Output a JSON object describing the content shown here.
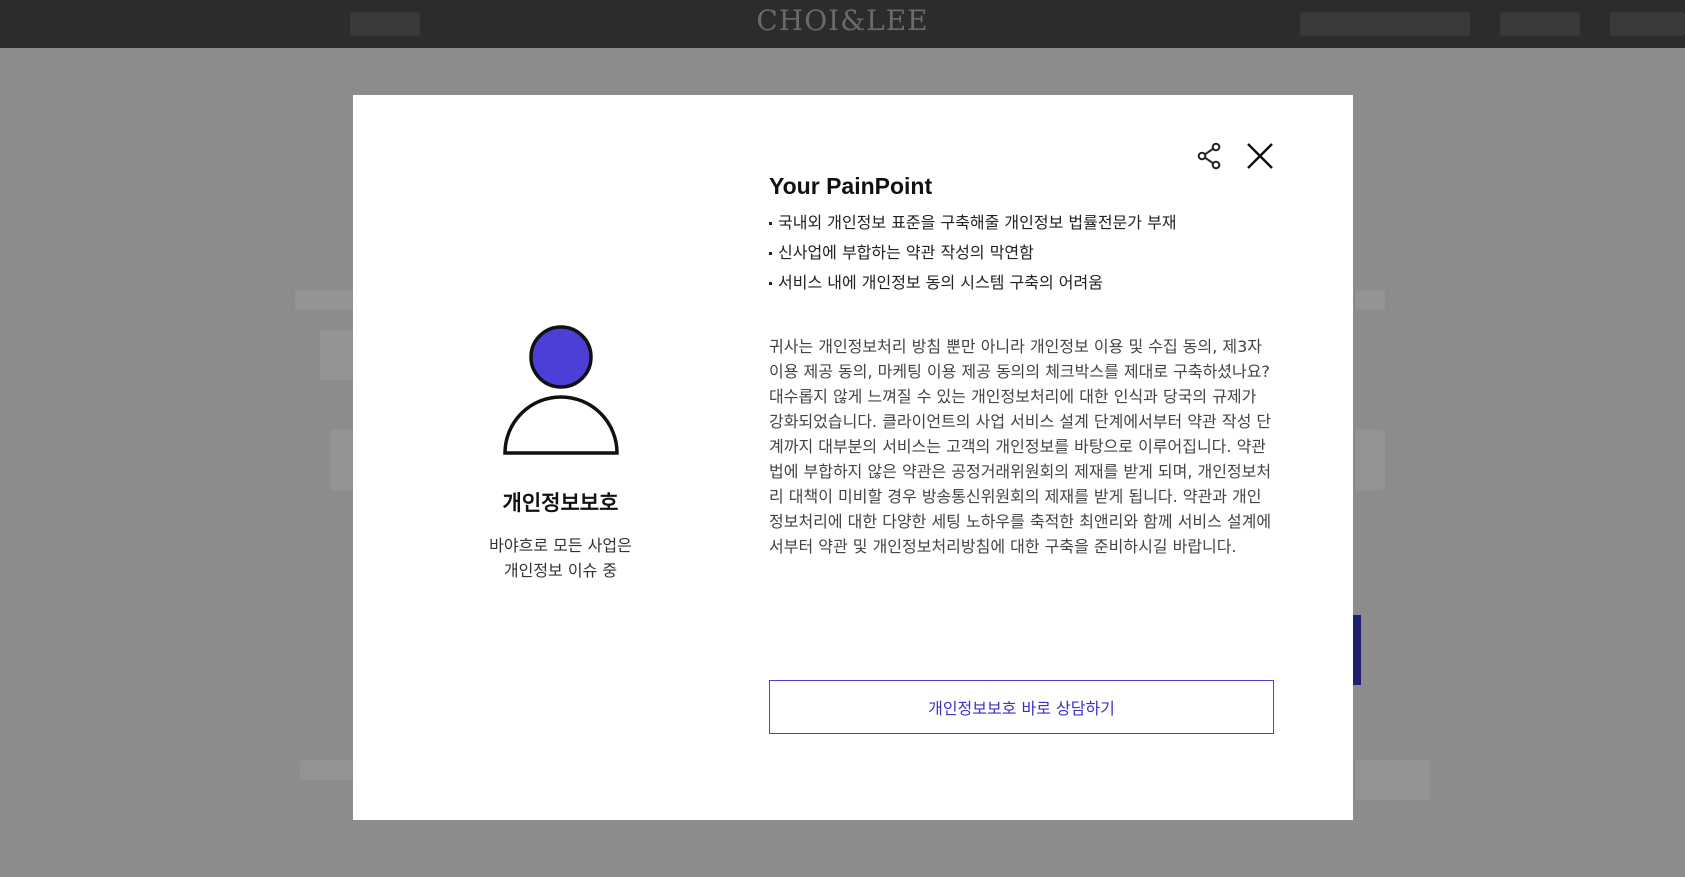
{
  "header": {
    "logo": "CHOI&LEE"
  },
  "modal": {
    "actions": {
      "share_icon": "share-icon",
      "close_icon": "close-icon"
    },
    "service": {
      "icon": "person-icon",
      "icon_color": "#4b3fd8",
      "title": "개인정보보호",
      "subtitle_line1": "바야흐로 모든 사업은",
      "subtitle_line2": "개인정보 이슈 중"
    },
    "painpoint": {
      "title": "Your PainPoint",
      "items": [
        "국내외 개인정보 표준을 구축해줄 개인정보 법률전문가 부재",
        "신사업에 부합하는 약관 작성의 막연함",
        "서비스 내에 개인정보 동의 시스템 구축의 어려움"
      ],
      "description": "귀사는 개인정보처리 방침 뿐만 아니라 개인정보 이용 및 수집 동의, 제3자 이용 제공 동의, 마케팅 이용 제공 동의의 체크박스를 제대로 구축하셨나요? 대수롭지 않게 느껴질 수 있는 개인정보처리에 대한 인식과 당국의 규제가 강화되었습니다. 클라이언트의 사업 서비스 설계 단계에서부터 약관 작성 단계까지 대부분의 서비스는 고객의 개인정보를 바탕으로 이루어집니다. 약관법에 부합하지 않은 약관은 공정거래위원회의 제재를 받게 되며, 개인정보처리 대책이 미비할 경우 방송통신위원회의 제재를 받게 됩니다. 약관과 개인정보처리에 대한 다양한 세팅 노하우를 축적한 최앤리와 함께 서비스 설계에서부터 약관 및 개인정보처리방침에 대한 구축을 준비하시길 바랍니다."
    },
    "cta_label": "개인정보보호 바로 상담하기",
    "accent_color": "#4b3fd4"
  }
}
